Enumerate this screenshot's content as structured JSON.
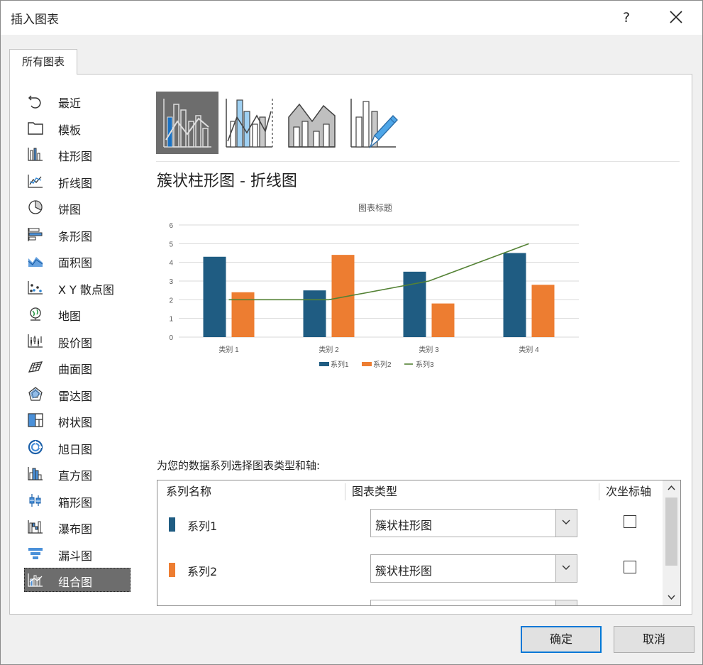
{
  "window": {
    "title": "插入图表",
    "help": "?",
    "close_icon": "close-icon"
  },
  "tab": {
    "label": "所有图表"
  },
  "sidebar": {
    "items": [
      {
        "label": "最近",
        "icon": "recent-icon"
      },
      {
        "label": "模板",
        "icon": "template-folder-icon"
      },
      {
        "label": "柱形图",
        "icon": "column-chart-icon"
      },
      {
        "label": "折线图",
        "icon": "line-chart-icon"
      },
      {
        "label": "饼图",
        "icon": "pie-chart-icon"
      },
      {
        "label": "条形图",
        "icon": "bar-chart-icon"
      },
      {
        "label": "面积图",
        "icon": "area-chart-icon"
      },
      {
        "label": "X Y 散点图",
        "icon": "scatter-chart-icon"
      },
      {
        "label": "地图",
        "icon": "map-chart-icon"
      },
      {
        "label": "股价图",
        "icon": "stock-chart-icon"
      },
      {
        "label": "曲面图",
        "icon": "surface-chart-icon"
      },
      {
        "label": "雷达图",
        "icon": "radar-chart-icon"
      },
      {
        "label": "树状图",
        "icon": "treemap-chart-icon"
      },
      {
        "label": "旭日图",
        "icon": "sunburst-chart-icon"
      },
      {
        "label": "直方图",
        "icon": "histogram-chart-icon"
      },
      {
        "label": "箱形图",
        "icon": "box-whisker-chart-icon"
      },
      {
        "label": "瀑布图",
        "icon": "waterfall-chart-icon"
      },
      {
        "label": "漏斗图",
        "icon": "funnel-chart-icon"
      },
      {
        "label": "组合图",
        "icon": "combo-chart-icon"
      }
    ],
    "selected_index": 18
  },
  "subtypes": {
    "items": [
      {
        "icon": "clustered-column-line-icon",
        "selected": true
      },
      {
        "icon": "clustered-column-line-secondary-axis-icon",
        "selected": false
      },
      {
        "icon": "stacked-area-clustered-column-icon",
        "selected": false
      },
      {
        "icon": "custom-combination-icon",
        "selected": false
      }
    ]
  },
  "selected_subtype_title": "簇状柱形图 - 折线图",
  "colors": {
    "series1": "#1f5c82",
    "series2": "#ed7d31",
    "series3": "#548235",
    "accent": "#0078d7",
    "selected_bg": "#6d6d6d"
  },
  "chart_data": {
    "type": "bar",
    "title": "图表标题",
    "categories": [
      "类别 1",
      "类别 2",
      "类别 3",
      "类别 4"
    ],
    "series": [
      {
        "name": "系列1",
        "type": "bar",
        "color": "#1f5c82",
        "values": [
          4.3,
          2.5,
          3.5,
          4.5
        ]
      },
      {
        "name": "系列2",
        "type": "bar",
        "color": "#ed7d31",
        "values": [
          2.4,
          4.4,
          1.8,
          2.8
        ]
      },
      {
        "name": "系列3",
        "type": "line",
        "color": "#548235",
        "values": [
          2,
          2,
          3,
          5
        ]
      }
    ],
    "yticks": [
      "0",
      "1",
      "2",
      "3",
      "4",
      "5",
      "6"
    ],
    "ylim": [
      0,
      6
    ],
    "grid": true,
    "legend": "bottom"
  },
  "series_section": {
    "caption": "为您的数据系列选择图表类型和轴:",
    "headers": {
      "name": "系列名称",
      "type": "图表类型",
      "secondary_axis": "次坐标轴"
    },
    "rows": [
      {
        "name": "系列1",
        "color": "#1f5c82",
        "chart_type": "簇状柱形图",
        "secondary_axis": false
      },
      {
        "name": "系列2",
        "color": "#ed7d31",
        "chart_type": "簇状柱形图",
        "secondary_axis": false
      }
    ]
  },
  "buttons": {
    "ok": "确定",
    "cancel": "取消"
  }
}
